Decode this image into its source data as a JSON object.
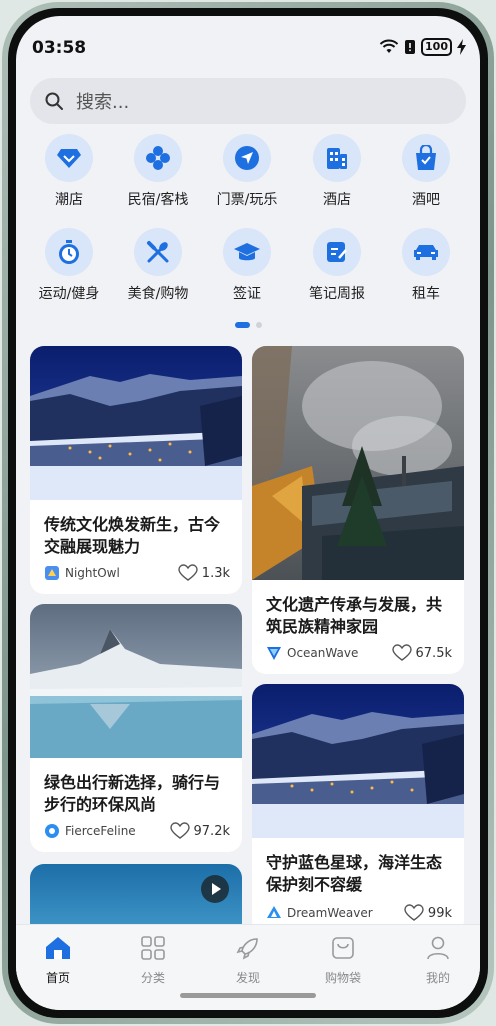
{
  "status_bar": {
    "time": "03:58",
    "battery": "100"
  },
  "search": {
    "placeholder": "搜索..."
  },
  "categories": [
    {
      "label": "潮店",
      "icon": "diamond-icon"
    },
    {
      "label": "民宿/客栈",
      "icon": "clover-icon"
    },
    {
      "label": "门票/玩乐",
      "icon": "send-icon"
    },
    {
      "label": "酒店",
      "icon": "building-icon"
    },
    {
      "label": "酒吧",
      "icon": "shopping-bag-icon"
    },
    {
      "label": "运动/健身",
      "icon": "stopwatch-icon"
    },
    {
      "label": "美食/购物",
      "icon": "utensils-icon"
    },
    {
      "label": "签证",
      "icon": "graduation-cap-icon"
    },
    {
      "label": "笔记周报",
      "icon": "note-edit-icon"
    },
    {
      "label": "租车",
      "icon": "car-icon"
    }
  ],
  "feed": [
    {
      "title": "传统文化焕发新生，古今交融展现魅力",
      "author": "NightOwl",
      "likes": "1.3k"
    },
    {
      "title": "文化遗产传承与发展，共筑民族精神家园",
      "author": "OceanWave",
      "likes": "67.5k"
    },
    {
      "title": "绿色出行新选择，骑行与步行的环保风尚",
      "author": "FierceFeline",
      "likes": "97.2k"
    },
    {
      "title": "守护蓝色星球，海洋生态保护刻不容缓",
      "author": "DreamWeaver",
      "likes": "99k"
    }
  ],
  "tabs": [
    {
      "label": "首页",
      "icon": "home-icon",
      "active": true
    },
    {
      "label": "分类",
      "icon": "grid-icon"
    },
    {
      "label": "发现",
      "icon": "rocket-icon"
    },
    {
      "label": "购物袋",
      "icon": "bag-icon"
    },
    {
      "label": "我的",
      "icon": "person-icon"
    }
  ],
  "colors": {
    "accent": "#1e6fe0",
    "icon_bg": "#d9e5f8",
    "background": "#f1f2f6"
  }
}
